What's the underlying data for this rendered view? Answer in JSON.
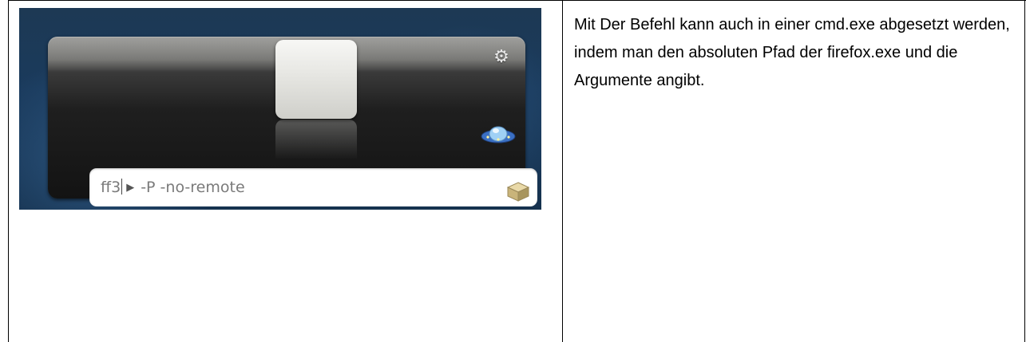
{
  "left_cell": {
    "screenshot": {
      "input": {
        "value_typed": "ff3",
        "arrow_glyph": "▶",
        "arguments": "-P -no-remote"
      },
      "icons": [
        "gear-icon",
        "box-icon",
        "ufo-icon"
      ],
      "colors": {
        "background": "#1a3a5c",
        "panel": "#1f1f1f",
        "input_bg": "#ffffff",
        "input_text": "#7a7a7a"
      }
    }
  },
  "right_cell": {
    "text": "Mit Der Befehl kann auch in einer cmd.exe abgesetzt werden, indem man den absoluten Pfad der firefox.exe und die Argumente angibt."
  }
}
